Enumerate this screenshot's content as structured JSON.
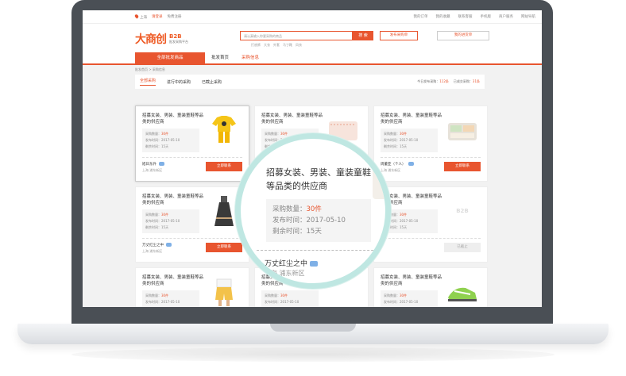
{
  "topbar": {
    "city": "上海",
    "login": "请登录",
    "register": "免费注册",
    "links": [
      "我的订单",
      "我的收藏",
      "联系客服",
      "手机版",
      "商户服务",
      "网站导航"
    ]
  },
  "header": {
    "logo": "大商创",
    "logo_b2b": "B2B",
    "logo_sub": "批发采购平台",
    "search_placeholder": "请认真输入你要采购的商品",
    "search_button": "搜 索",
    "hot_words": [
      "打底裤",
      "大衣",
      "外套",
      "马丁靴",
      "风衣"
    ],
    "publish_button": "发布采购单",
    "cart_button": "我的进货单"
  },
  "nav": {
    "all": "全部批发商品",
    "items": [
      "批发首页",
      "采购信息"
    ]
  },
  "breadcrumb": "批发首页 > 采购信息",
  "tabs": {
    "items": [
      "全部采购",
      "进行中的采购",
      "已截止采购"
    ],
    "stat_today_label": "今日发布采购：",
    "stat_today_value": "112条",
    "stat_done_label": "已成交采购：",
    "stat_done_value": "31条"
  },
  "card_text": {
    "title": "招募女装、男装、童装童鞋等品类的供应商",
    "qty_label": "采购数量：",
    "qty_value": "30件",
    "date_label": "发布时间：",
    "date_value": "2017-05-10",
    "left_label": "剩余时间：",
    "left_value": "15天",
    "contact": "立即联系",
    "ended": "已截止"
  },
  "cards": [
    {
      "seller": "旭日东升",
      "addr": "上海 浦东新区"
    },
    {
      "seller": "",
      "addr": ""
    },
    {
      "seller": "周董亚（个人）",
      "addr": "上海 浦东新区"
    },
    {
      "seller": "万丈红尘之中",
      "addr": "上海 浦东新区"
    },
    {
      "seller": "",
      "addr": ""
    },
    {
      "seller": "",
      "addr": ""
    }
  ],
  "magnifier": {
    "title": "招募女装、男装、童装童鞋等品类的供应商",
    "qty_label": "采购数量：",
    "qty_value": "30件",
    "date_label": "发布时间：",
    "date_value": "2017-05-10",
    "left_label": "剩余时间：",
    "left_value": "15天",
    "seller": "万丈红尘之中",
    "addr": "上海 浦东新区"
  },
  "colors": {
    "accent": "#e8552f",
    "frame": "#4a4f55",
    "lens": "#bfe7e2"
  }
}
